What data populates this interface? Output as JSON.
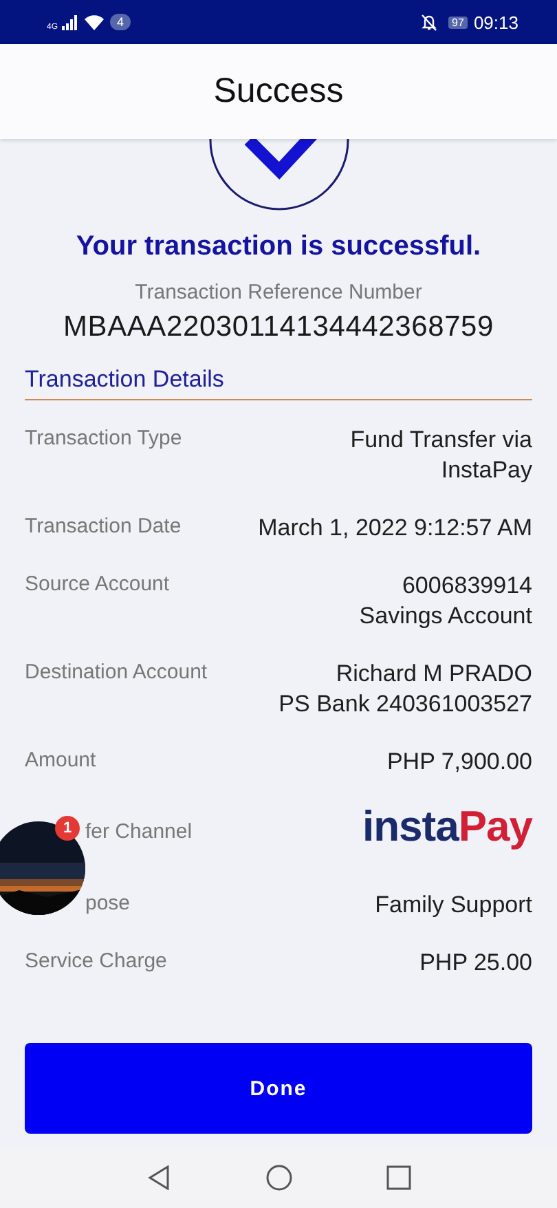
{
  "status_bar": {
    "network": "4G",
    "notification_count": "4",
    "battery": "97",
    "time": "09:13"
  },
  "header": {
    "title": "Success"
  },
  "message": "Your transaction is successful.",
  "reference": {
    "label": "Transaction Reference Number",
    "value": "MBAAA22030114134442368759"
  },
  "details": {
    "heading": "Transaction Details",
    "rows": [
      {
        "kind": "text",
        "label": "Transaction Type",
        "value": [
          "Fund Transfer via",
          "InstaPay"
        ]
      },
      {
        "kind": "text",
        "label": "Transaction Date",
        "value": [
          "March 1, 2022 9:12:57 AM"
        ]
      },
      {
        "kind": "text",
        "label": "Source Account",
        "value": [
          "6006839914",
          "Savings Account"
        ]
      },
      {
        "kind": "text",
        "label": "Destination Account",
        "value": [
          "Richard M PRADO",
          "PS Bank 240361003527"
        ]
      },
      {
        "kind": "text",
        "label": "Amount",
        "value": [
          "PHP 7,900.00"
        ]
      },
      {
        "kind": "logo",
        "label": "fer Channel",
        "partly_covered": true,
        "logo": {
          "part_1": "insta",
          "part_2": "Pay"
        }
      },
      {
        "kind": "text",
        "label": "pose",
        "partly_covered": true,
        "value": [
          "Family Support"
        ]
      },
      {
        "kind": "text",
        "label": "Service Charge",
        "value": [
          "PHP 25.00"
        ]
      }
    ]
  },
  "done_button": "Done",
  "chat_head": {
    "badge": "1"
  }
}
